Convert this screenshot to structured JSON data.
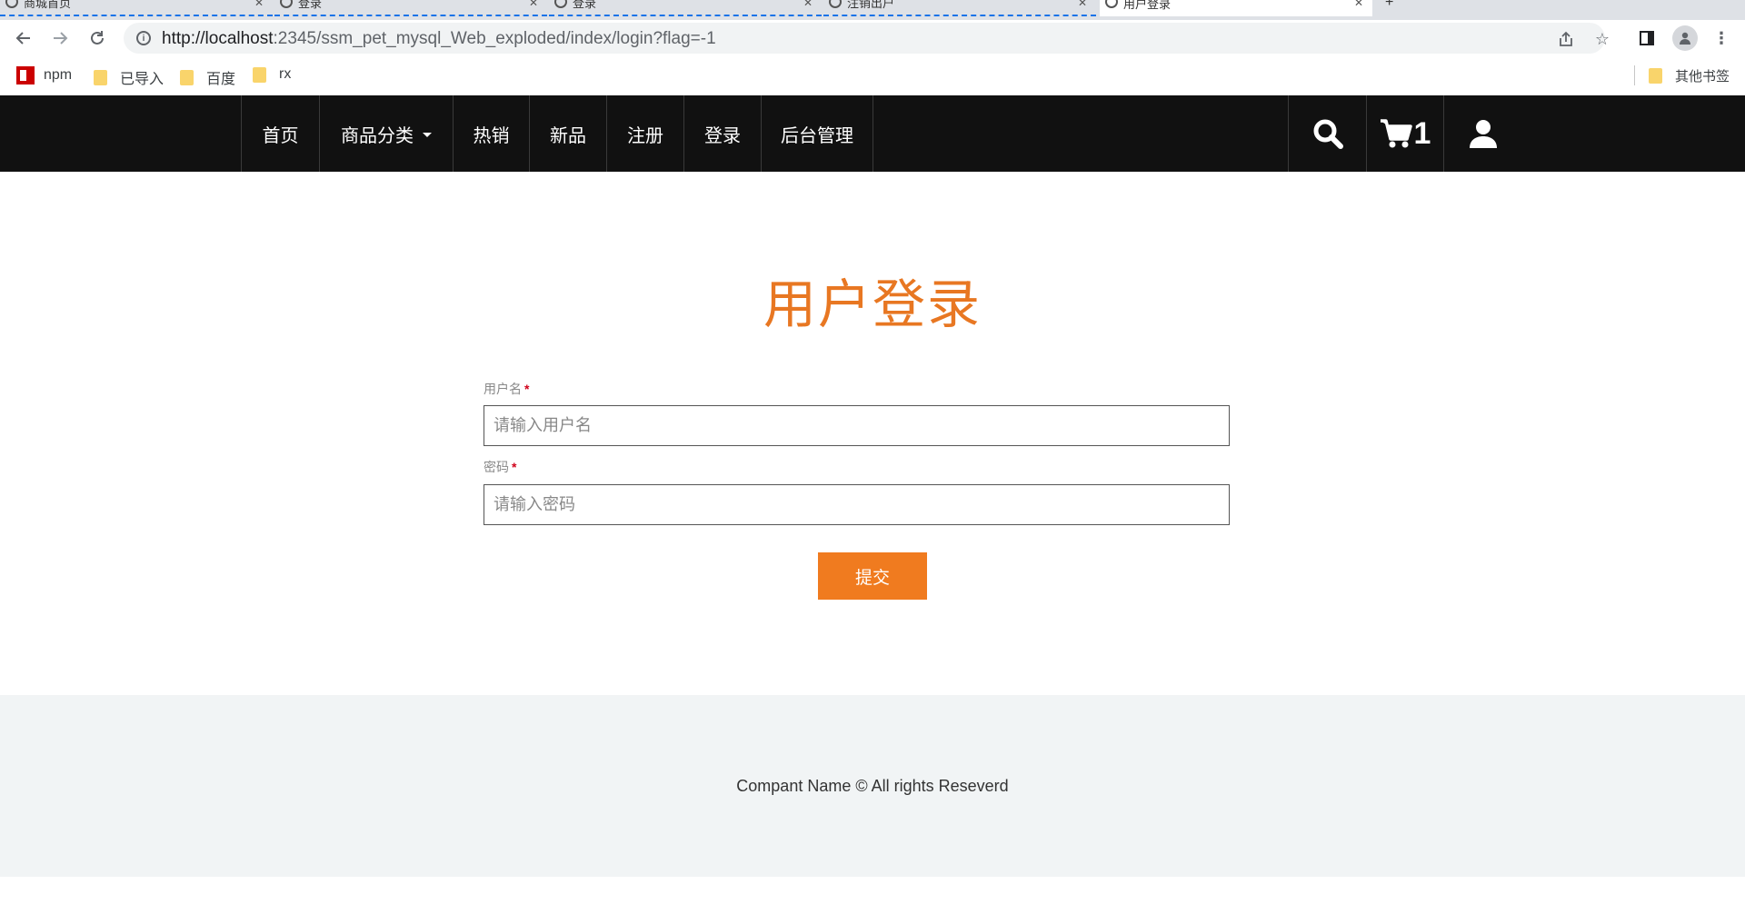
{
  "browser": {
    "tabs": [
      {
        "title": "商城首页"
      },
      {
        "title": "登录"
      },
      {
        "title": "登录"
      },
      {
        "title": "注销出户"
      },
      {
        "title": "用户登录",
        "active": true
      }
    ],
    "url_host": "http://localhost",
    "url_rest": ":2345/ssm_pet_mysql_Web_exploded/index/login?flag=-1",
    "bookmarks": [
      {
        "label": "npm",
        "icon": "npm-icon"
      },
      {
        "label": "已导入",
        "icon": "folder-icon"
      },
      {
        "label": "百度",
        "icon": "folder-icon"
      },
      {
        "label": "rx",
        "icon": "folder-icon"
      }
    ],
    "other_bookmarks": "其他书签"
  },
  "nav": {
    "items": [
      "首页",
      "商品分类",
      "热销",
      "新品",
      "注册",
      "登录",
      "后台管理"
    ],
    "cart_count": "1"
  },
  "login": {
    "title": "用户登录",
    "username_label": "用户名",
    "username_placeholder": "请输入用户名",
    "password_label": "密码",
    "password_placeholder": "请输入密码",
    "required_mark": "*",
    "submit_label": "提交"
  },
  "footer": {
    "text": "Compant Name © All rights Reseverd"
  },
  "colors": {
    "accent": "#f07b1f",
    "title": "#e87722",
    "nav_bg": "#111111",
    "footer_bg": "#f1f4f5"
  }
}
